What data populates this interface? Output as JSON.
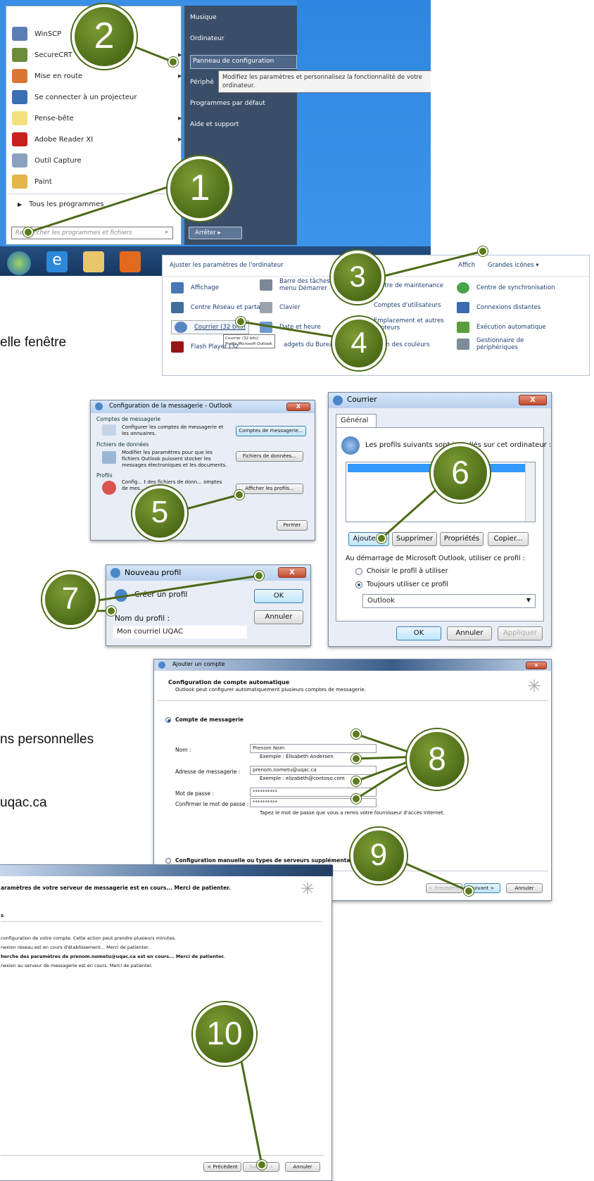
{
  "background_texts": {
    "t1": "elle fenêtre",
    "t2": "ns personnelles",
    "t3": "uqac.ca"
  },
  "start_menu": {
    "left_items": [
      "WinSCP",
      "SecureCRT",
      "Mise en route",
      "Se connecter à un projecteur",
      "Pense-bête",
      "Adobe Reader XI",
      "Outil Capture",
      "Paint"
    ],
    "all_programs": "Tous les programmes",
    "search_placeholder": "Rechercher les programmes et fichiers",
    "right_items": [
      "Musique",
      "Ordinateur",
      "Panneau de configuration",
      "Périphé",
      "Programmes par défaut",
      "Aide et support"
    ],
    "tooltip": "Modifiez les paramètres et personnalisez la fonctionnalité de votre ordinateur.",
    "shutdown": "Arrêter"
  },
  "control_panel": {
    "title": "Ajuster les paramètres de l'ordinateur",
    "view_by": "Affich",
    "view_value": "Grandes icônes ▾",
    "items": {
      "affichage": "Affichage",
      "barre": "Barre des tâches et menu Démarrer",
      "centre_maint": "ntre de maintenance",
      "centre_sync": "Centre de synchronisation",
      "reseau": "Centre Réseau et partage",
      "clavier": "Clavier",
      "comptes": "Comptes d'utilisateurs",
      "connexions": "Connexions distantes",
      "courrier": "Courrier (32 bits)",
      "date": "Date et heure",
      "emplacement": "Emplacement et autres capteurs",
      "execution": "Exécution automatique",
      "flash": "Flash Player (32",
      "gadgets": "adgets du Bureau",
      "couleurs": "ion des couleurs",
      "gestionnaire": "Gestionnaire de périphériques"
    },
    "courrier_tooltip1": "Courrier (32 bits)",
    "courrier_tooltip2": "Profils Microsoft Outlook"
  },
  "outlook_config": {
    "title": "Configuration de la messagerie - Outlook",
    "grp_comptes": "Comptes de messagerie",
    "desc_comptes": "Configurer les comptes de messagerie et les annuaires.",
    "btn_comptes": "Comptes de messagerie...",
    "grp_fichiers": "Fichiers de données",
    "desc_fichiers": "Modifier les paramètres pour que les fichiers Outlook puissent stocker les messages électroniques et les documents.",
    "btn_fichiers": "Fichiers de données...",
    "grp_profils": "Profils",
    "desc_profils": "Config... t des fichiers de donn... omptes de mes... seur suivi.",
    "btn_profils": "Afficher les profils...",
    "btn_fermer": "Fermer"
  },
  "courrier": {
    "title": "Courrier",
    "tab": "Général",
    "heading": "Les profils suivants sont installés sur cet ordinateur :",
    "btn_ajouter": "Ajouter...",
    "btn_supprimer": "Supprimer",
    "btn_proprietes": "Propriétés",
    "btn_copier": "Copier...",
    "startup_label": "Au démarrage de Microsoft Outlook, utiliser ce profil :",
    "radio1": "Choisir le profil à utiliser",
    "radio2": "Toujours utiliser ce profil",
    "profile_select": "Outlook",
    "btn_ok": "OK",
    "btn_annuler": "Annuler",
    "btn_appliquer": "Appliquer"
  },
  "nouveau_profil": {
    "title": "Nouveau profil",
    "create": "Créer un profil",
    "label": "Nom du profil :",
    "value": "Mon courriel UQAC",
    "btn_ok": "OK",
    "btn_annuler": "Annuler"
  },
  "ajouter_compte": {
    "title": "Ajouter un compte",
    "heading": "Configuration de compte automatique",
    "subheading": "Outlook peut configurer automatiquement plusieurs comptes de messagerie.",
    "radio_compte": "Compte de messagerie",
    "nom_label": "Nom :",
    "nom_value": "Prenom Nom",
    "nom_example": "Exemple : Élisabeth Andersen",
    "adresse_label": "Adresse de messagerie :",
    "adresse_value": "prenom.nometu@uqac.ca",
    "adresse_example": "Exemple : elizabeth@contoso.com",
    "mdp_label": "Mot de passe :",
    "mdp_value": "**********",
    "confirm_label": "Confirmer le mot de passe :",
    "confirm_value": "**********",
    "mdp_hint": "Tapez le mot de passe que vous a remis votre fournisseur d'accès Internet.",
    "radio_manuelle": "Configuration manuelle ou types de serveurs supplémentaires",
    "btn_precedent": "< Précédent",
    "btn_suivant": "Suivant >",
    "btn_annuler": "Annuler"
  },
  "progress_dialog": {
    "heading": "aramètres de votre serveur de messagerie est en cours... Merci de patienter.",
    "section": "s",
    "lines": [
      "configuration de votre compte. Cette action peut prendre plusieurs minutes.",
      "nexion réseau est en cours d'établissement... Merci de patienter.",
      "herche des paramètres de prenom.nometu@uqac.ca est en cours... Merci de patienter.",
      "nexion au serveur de messagerie est en cours. Merci de patienter."
    ],
    "btn_precedent": "< Précédent",
    "btn_suivant": "Suivant >",
    "btn_annuler": "Annuler"
  },
  "callouts": [
    "1",
    "2",
    "3",
    "4",
    "5",
    "6",
    "7",
    "8",
    "9",
    "10"
  ]
}
